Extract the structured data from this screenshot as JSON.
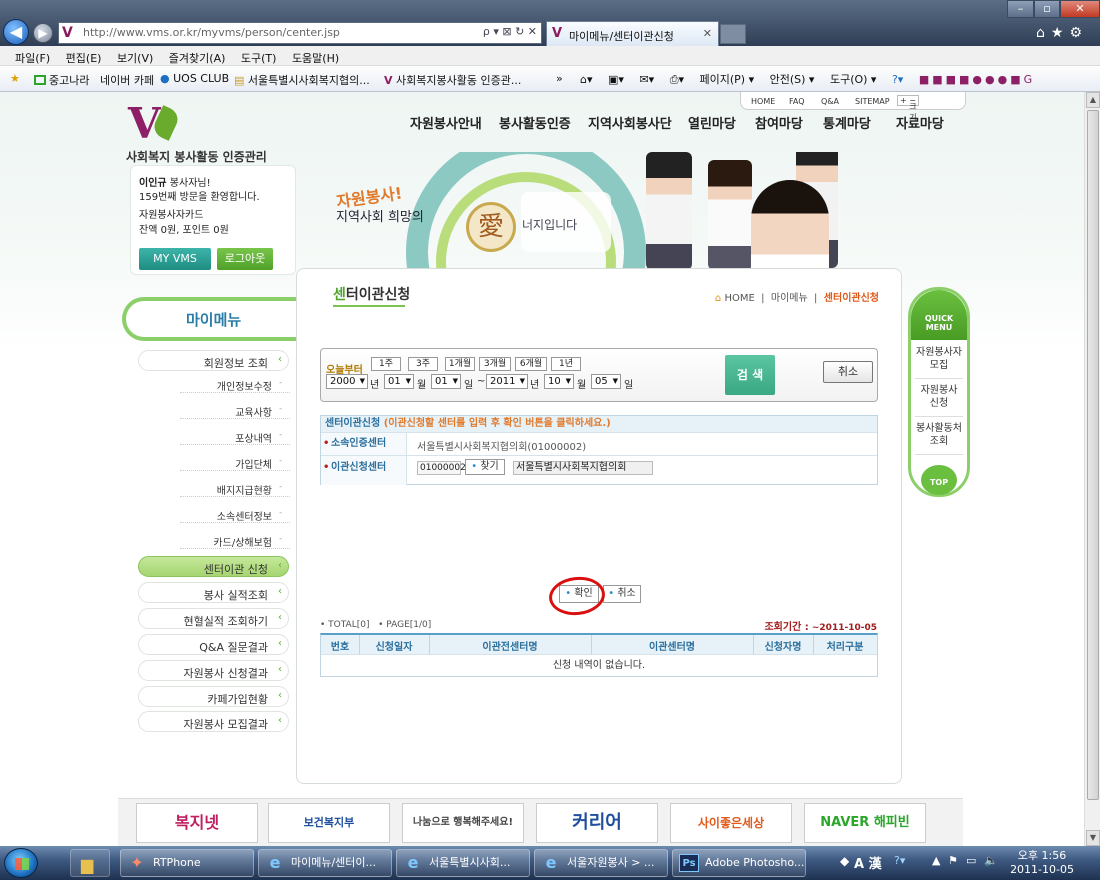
{
  "browser": {
    "url": "http://www.vms.or.kr/myvms/person/center.jsp",
    "tab_title": "마이메뉴/센터이관신청",
    "addr_controls": "ρ ▾ ⊠ ↻ ✕",
    "menu": [
      "파일(F)",
      "편집(E)",
      "보기(V)",
      "즐겨찾기(A)",
      "도구(T)",
      "도움말(H)"
    ],
    "favorites": [
      "중고나라",
      "네이버 카페",
      "UOS CLUB",
      "서울특별시사회복지협의...",
      "사회복지봉사활동 인증관..."
    ],
    "fav_more": "»",
    "commands": [
      "페이지(P) ▾",
      "안전(S) ▾",
      "도구(O) ▾"
    ]
  },
  "site": {
    "logo_letter": "V",
    "logo_text": "사회복지 봉사활동 인증관리",
    "util_links": [
      "HOME",
      "FAQ",
      "Q&A",
      "SITEMAP"
    ],
    "font_size_label": "크기",
    "gnb": [
      "자원봉사안내",
      "봉사활동인증",
      "지역사회봉사단",
      "열린마당",
      "참여마당",
      "통계마당",
      "자료마당"
    ],
    "hero": {
      "slogan_top": "자원봉사!",
      "slogan_mid": "지역사회 희망의",
      "slogan_char": "愛",
      "slogan_end": "너지입니다"
    }
  },
  "login": {
    "name": "이인규",
    "suffix": " 봉사자님!",
    "visit": "159번째 방문을 환영합니다.",
    "card": "자원봉사자카드",
    "balance": "잔액 0원, 포인트 0원",
    "myvms_btn": "MY VMS",
    "logout_btn": "로그아웃"
  },
  "mymenu": {
    "title": "마이메뉴",
    "items": [
      {
        "label": "회원정보 조회"
      },
      {
        "label": "개인정보수정"
      },
      {
        "label": "교육사항"
      },
      {
        "label": "포상내역"
      },
      {
        "label": "가입단체"
      },
      {
        "label": "배지지급현황"
      },
      {
        "label": "소속센터정보"
      },
      {
        "label": "카드/상해보험"
      },
      {
        "label": "센터이관 신청"
      },
      {
        "label": "봉사 실적조회"
      },
      {
        "label": "현혈실적 조회하기"
      },
      {
        "label": "Q&A 질문결과"
      },
      {
        "label": "자원봉사 신청결과"
      },
      {
        "label": "카페가입현황"
      },
      {
        "label": "자원봉사 모집결과"
      }
    ]
  },
  "content": {
    "title_first": "센",
    "title_rest": "터이관신청",
    "breadcrumb": {
      "home": "HOME",
      "parent": "마이메뉴",
      "current": "센터이관신청"
    },
    "search": {
      "from_today": "오늘부터",
      "periods": [
        "1주",
        "3주",
        "1개월",
        "3개월",
        "6개월",
        "1년"
      ],
      "start": {
        "year": "2000",
        "month": "01",
        "day": "01"
      },
      "end": {
        "year": "2011",
        "month": "10",
        "day": "05"
      },
      "units": {
        "year": "년",
        "month": "월",
        "day": "일"
      },
      "tilde": "~",
      "search_btn": "검 색",
      "cancel_btn": "취소"
    },
    "form": {
      "title": "센터이관신청",
      "hint": "(이관신청할 센터를 입력 후 확인 버튼을 클릭하세요.)",
      "current_label": "소속인증센터",
      "current_value": "서울특별시사회복지협의회(01000002)",
      "target_label": "이관신청센터",
      "target_code": "01000002",
      "find_btn": "찾기",
      "target_name": "서울특별시사회복지협의회",
      "ok_btn": "확인",
      "cancel_btn": "취소"
    },
    "list": {
      "total": "• TOTAL[0]",
      "page": "• PAGE[1/0]",
      "period_label": "조회기간 :",
      "period_value": " ~2011-10-05",
      "headers": [
        "번호",
        "신청일자",
        "이관전센터명",
        "이관센터명",
        "신청자명",
        "처리구분"
      ],
      "empty": "신청 내역이 없습니다."
    }
  },
  "quick": {
    "title": "QUICK MENU",
    "items": [
      "자원봉사자 모집",
      "자원봉사 신청",
      "봉사활동처 조회"
    ],
    "top": "TOP"
  },
  "footer": {
    "banners": [
      "복지넷",
      "보건복지부",
      "나눔으로 행복해주세요!",
      "커리어",
      "사이좋은세상",
      "NAVER 해피빈"
    ]
  },
  "taskbar": {
    "items": [
      "RTPhone",
      "마이메뉴/센터이...",
      "서울특별시사회...",
      "서울자원봉사 > ...",
      "Adobe Photosho..."
    ],
    "ime": "A 漢",
    "time": "오후 1:56",
    "date": "2011-10-05"
  },
  "colors": {
    "accent_green": "#7cc44f",
    "brand_purple": "#8c1f66",
    "teal": "#3aa882",
    "highlight_red": "#d90f10"
  }
}
